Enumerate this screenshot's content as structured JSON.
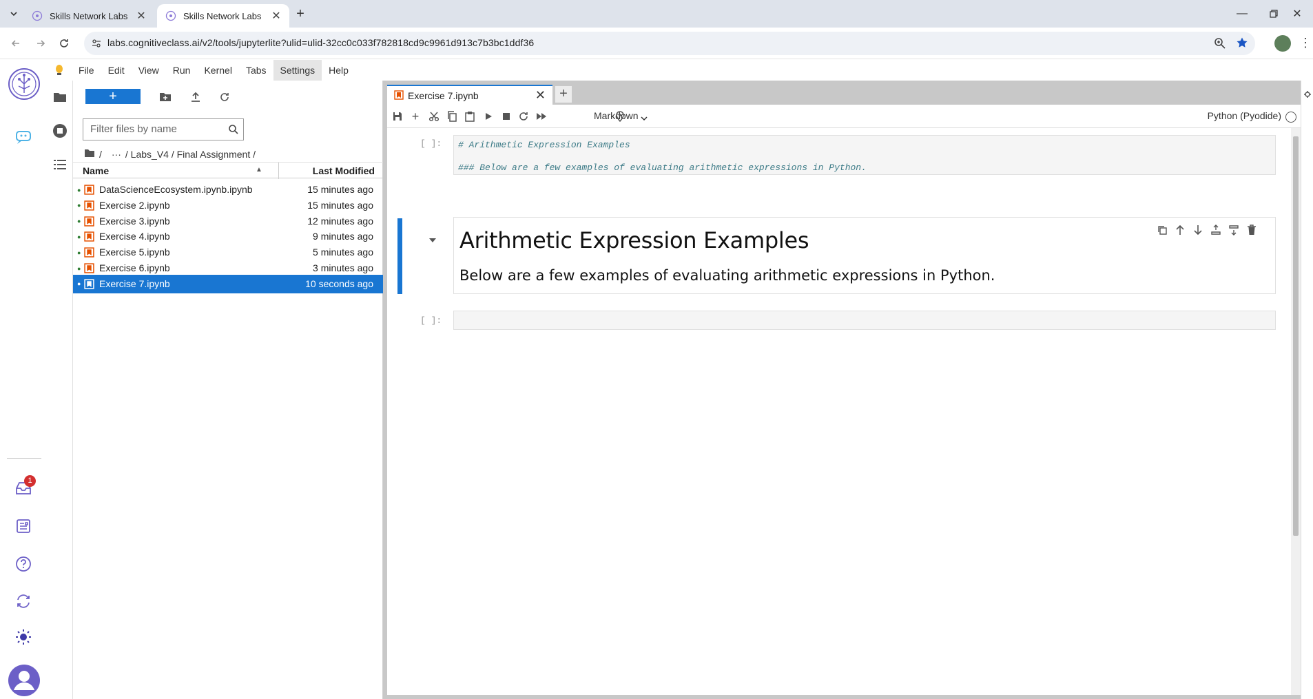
{
  "browser": {
    "tabs": [
      {
        "title": "Skills Network Labs",
        "active": false
      },
      {
        "title": "Skills Network Labs",
        "active": true
      }
    ],
    "new_tab_icon": "plus-icon",
    "url": "labs.cognitiveclass.ai/v2/tools/jupyterlite?ulid=ulid-32cc0c033f782818cd9c9961d913c7b3bc1ddf36"
  },
  "menubar": {
    "items": [
      "File",
      "Edit",
      "View",
      "Run",
      "Kernel",
      "Tabs",
      "Settings",
      "Help"
    ],
    "highlighted": "Settings"
  },
  "leftbar": {
    "notification_count": "1",
    "icons": [
      "logo-icon",
      "chat-icon",
      "inbox-icon",
      "notes-icon",
      "help-icon",
      "sync-icon",
      "theme-icon",
      "user-icon"
    ]
  },
  "filebrowser": {
    "new_button": "+",
    "filter_placeholder": "Filter files by name",
    "breadcrumb": {
      "root": "/",
      "ellipsis": "···",
      "path": "/ Labs_V4 / Final Assignment /"
    },
    "columns": {
      "name": "Name",
      "modified": "Last Modified"
    },
    "files": [
      {
        "name": "DataScienceEcosystem.ipynb.ipynb",
        "modified": "15 minutes ago"
      },
      {
        "name": "Exercise 2.ipynb",
        "modified": "15 minutes ago"
      },
      {
        "name": "Exercise 3.ipynb",
        "modified": "12 minutes ago"
      },
      {
        "name": "Exercise 4.ipynb",
        "modified": "9 minutes ago"
      },
      {
        "name": "Exercise 5.ipynb",
        "modified": "5 minutes ago"
      },
      {
        "name": "Exercise 6.ipynb",
        "modified": "3 minutes ago"
      },
      {
        "name": "Exercise 7.ipynb",
        "modified": "10 seconds ago",
        "selected": true
      }
    ]
  },
  "notebook": {
    "tab_title": "Exercise 7.ipynb",
    "add_tab": "+",
    "cell_type": "Markdown",
    "kernel": "Python (Pyodide)",
    "cells": [
      {
        "prompt": "[ ]:",
        "source_line1": "# Arithmetic Expression Examples",
        "source_line2": "### Below are a few examples of evaluating arithmetic expressions in Python."
      },
      {
        "heading": "Arithmetic Expression Examples",
        "paragraph": "Below are a few examples of evaluating arithmetic expressions in Python."
      },
      {
        "prompt": "[ ]:"
      }
    ]
  },
  "colors": {
    "accent": "#1976d2",
    "notebook_orange": "#e65100",
    "chrome_bg": "#dee3eb"
  }
}
